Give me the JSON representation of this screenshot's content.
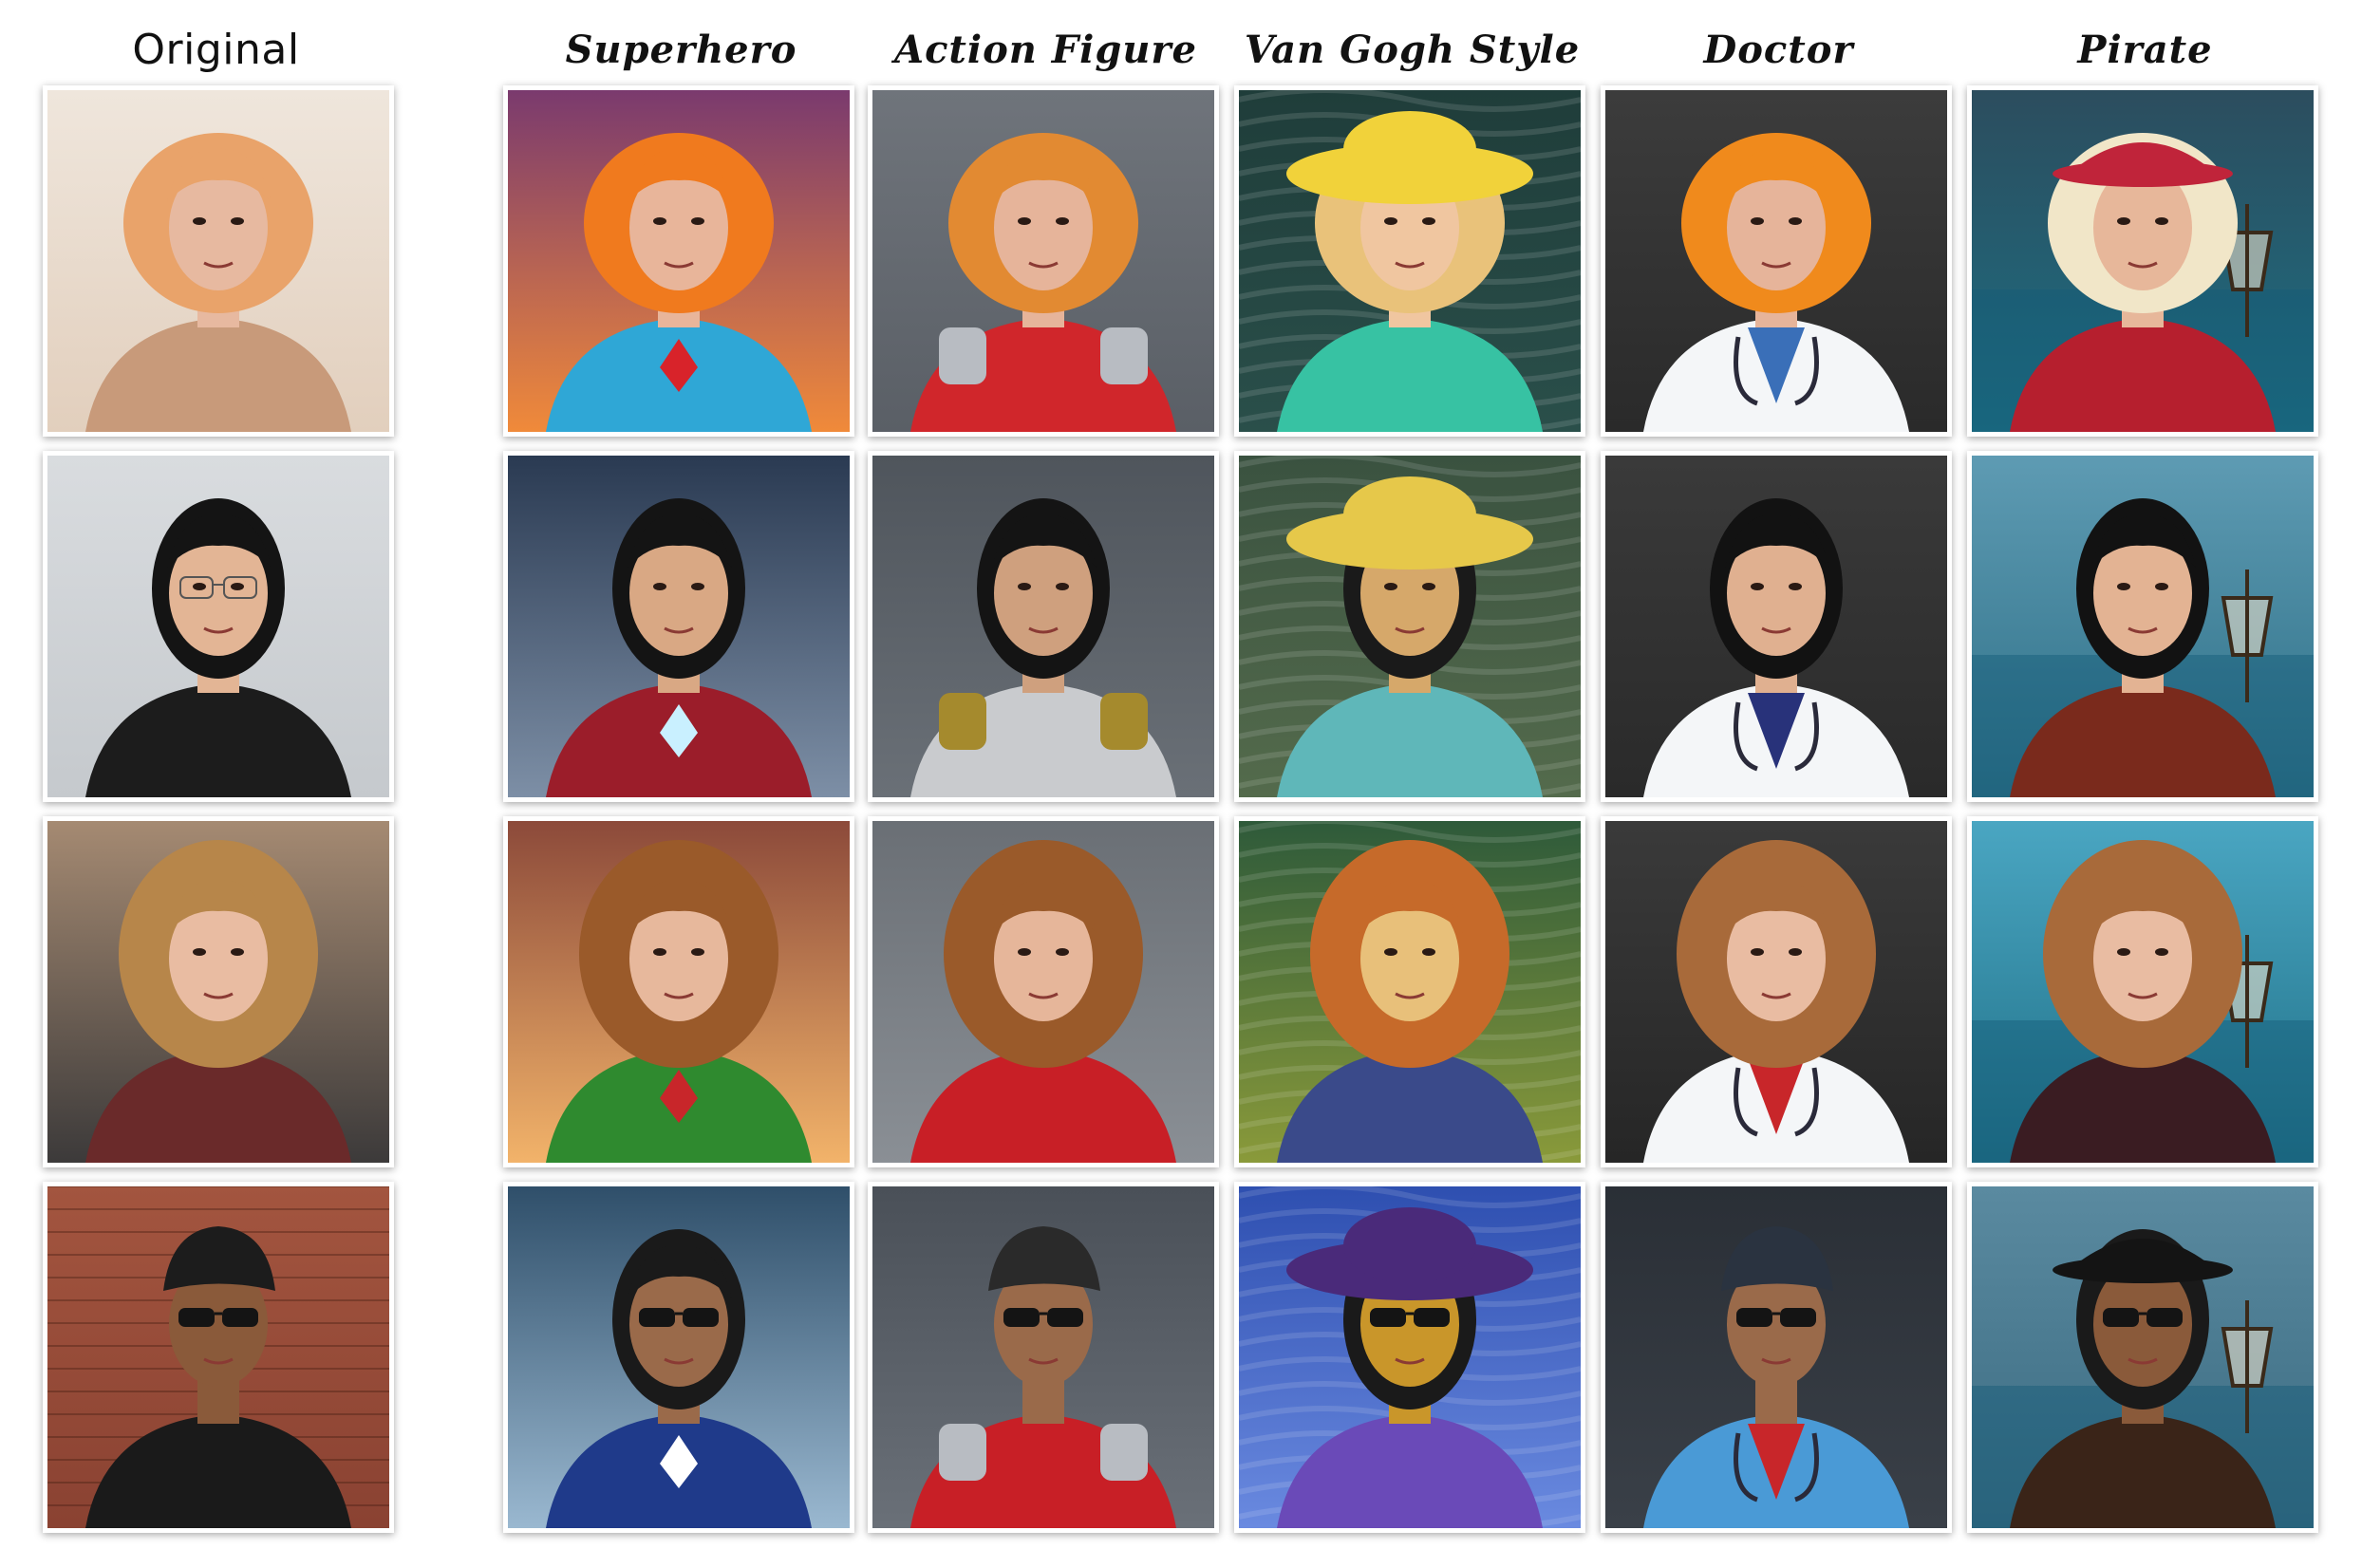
{
  "headers": {
    "original": "Original",
    "styles": [
      "Superhero",
      "Action Figure",
      "Van Gogh Style",
      "Doctor",
      "Pirate"
    ]
  },
  "rows": [
    {
      "subject": "woman-orange-hair",
      "cells": [
        {
          "style": "original",
          "bg": [
            "#efe6dc",
            "#e2cfbd"
          ],
          "hair": "#e9a36a",
          "skin": "#e7b9a0",
          "body": "#c89a7a",
          "hat": ""
        },
        {
          "style": "superhero",
          "bg": [
            "#7a3a6e",
            "#f08a3a"
          ],
          "hair": "#f07a1e",
          "skin": "#e8b59a",
          "body": "#2fa7d6",
          "hat": "",
          "accent": "#d8232a"
        },
        {
          "style": "action-figure",
          "bg": [
            "#6f747b",
            "#5a5f66"
          ],
          "hair": "#e28a32",
          "skin": "#e6b49a",
          "body": "#d0262b",
          "hat": "",
          "accent": "#b8bcc2"
        },
        {
          "style": "van-gogh",
          "bg": [
            "#1f3d3a",
            "#2a4f4a"
          ],
          "hair": "#e9c27a",
          "skin": "#f0c6a0",
          "body": "#37c2a3",
          "hat": "#f1d23a"
        },
        {
          "style": "doctor",
          "bg": [
            "#3c3c3c",
            "#2a2a2a"
          ],
          "hair": "#f08a1c",
          "skin": "#e6b49a",
          "body": "#f4f6f8",
          "hat": "",
          "accent": "#3a6fb8"
        },
        {
          "style": "pirate",
          "bg": [
            "#2c4d5e",
            "#1c6f83"
          ],
          "hair": "#f1e6c8",
          "skin": "#e7b79a",
          "body": "#b61f2e",
          "hat": "#c0243a"
        }
      ]
    },
    {
      "subject": "man-glasses",
      "cells": [
        {
          "style": "original",
          "bg": [
            "#d9dcdf",
            "#c5c9cd"
          ],
          "hair": "#141414",
          "skin": "#e3b595",
          "body": "#1c1c1c",
          "hat": "",
          "glasses": true
        },
        {
          "style": "superhero",
          "bg": [
            "#2a3a52",
            "#7d8fa6"
          ],
          "hair": "#141414",
          "skin": "#d9a884",
          "body": "#9b1d2a",
          "hat": "",
          "accent": "#c9f0ff"
        },
        {
          "style": "action-figure",
          "bg": [
            "#4f555c",
            "#6a7077"
          ],
          "hair": "#141414",
          "skin": "#cfa07e",
          "body": "#c9cbce",
          "hat": "",
          "accent": "#a58a2d"
        },
        {
          "style": "van-gogh",
          "bg": [
            "#3a5240",
            "#546b4c"
          ],
          "hair": "#1a1a1a",
          "skin": "#d6a86a",
          "body": "#5fb7b9",
          "hat": "#e6c84a"
        },
        {
          "style": "doctor",
          "bg": [
            "#3a3a3a",
            "#2a2a2a"
          ],
          "hair": "#121212",
          "skin": "#e0b090",
          "body": "#f4f6f8",
          "hat": "",
          "accent": "#28327a"
        },
        {
          "style": "pirate",
          "bg": [
            "#5e9bb3",
            "#2d6f86"
          ],
          "hair": "#121212",
          "skin": "#e3b393",
          "body": "#7a2a1c",
          "hat": ""
        }
      ]
    },
    {
      "subject": "woman-long-hair",
      "cells": [
        {
          "style": "original",
          "bg": [
            "#a58a72",
            "#3c3a3a"
          ],
          "hair": "#b7864a",
          "skin": "#e9bca2",
          "body": "#6a2a2a",
          "hat": ""
        },
        {
          "style": "superhero",
          "bg": [
            "#8c4a3a",
            "#f2b36a"
          ],
          "hair": "#9a5a2a",
          "skin": "#e7b89c",
          "body": "#2f8a2f",
          "hat": "",
          "accent": "#c8262a"
        },
        {
          "style": "action-figure",
          "bg": [
            "#6a6f75",
            "#8a8f95"
          ],
          "hair": "#9a5a2a",
          "skin": "#e6b69a",
          "body": "#c81f26",
          "hat": ""
        },
        {
          "style": "van-gogh",
          "bg": [
            "#2e5a3a",
            "#8a9a3a"
          ],
          "hair": "#c66a2a",
          "skin": "#e8c07a",
          "body": "#3a4a8a",
          "hat": ""
        },
        {
          "style": "doctor",
          "bg": [
            "#3a3a3a",
            "#262626"
          ],
          "hair": "#a86a3a",
          "skin": "#e9bca2",
          "body": "#f4f6f8",
          "hat": "",
          "accent": "#c8262a"
        },
        {
          "style": "pirate",
          "bg": [
            "#4aa6c2",
            "#1f6f86"
          ],
          "hair": "#a86a3a",
          "skin": "#e9bca2",
          "body": "#3a1c22",
          "hat": ""
        }
      ]
    },
    {
      "subject": "man-sunglasses-headwrap",
      "cells": [
        {
          "style": "original",
          "bg": [
            "#a3553f",
            "#8a4232"
          ],
          "hair": "#1a1a1a",
          "skin": "#8a5a3a",
          "body": "#1a1a1a",
          "hat": "#1c1c1c",
          "sunglasses": true
        },
        {
          "style": "superhero",
          "bg": [
            "#2f4f6a",
            "#9ab8d0"
          ],
          "hair": "#1a1a1a",
          "skin": "#9a6a4a",
          "body": "#1f3a8a",
          "hat": "",
          "sunglasses": true,
          "accent": "#ffffff"
        },
        {
          "style": "action-figure",
          "bg": [
            "#4a5058",
            "#6a7078"
          ],
          "hair": "#1a1a1a",
          "skin": "#9a6a4a",
          "body": "#c81f26",
          "hat": "#2a2a2a",
          "sunglasses": true,
          "accent": "#b8bcc2"
        },
        {
          "style": "van-gogh",
          "bg": [
            "#2e4fb0",
            "#6a8ae0"
          ],
          "hair": "#1a1a1a",
          "skin": "#c9962a",
          "body": "#6a4ab8",
          "hat": "#4a2a7a",
          "sunglasses": true
        },
        {
          "style": "doctor",
          "bg": [
            "#2a2f36",
            "#3a4048"
          ],
          "hair": "#1a1a1a",
          "skin": "#9a6a4a",
          "body": "#4a9ad6",
          "hat": "#2a3340",
          "sunglasses": true,
          "accent": "#c8262a"
        },
        {
          "style": "pirate",
          "bg": [
            "#5a8aa0",
            "#3a6a80"
          ],
          "hair": "#1a1a1a",
          "skin": "#8a5a3a",
          "body": "#3a2418",
          "hat": "#141414",
          "sunglasses": true,
          "accent": "#c8262a"
        }
      ]
    }
  ]
}
